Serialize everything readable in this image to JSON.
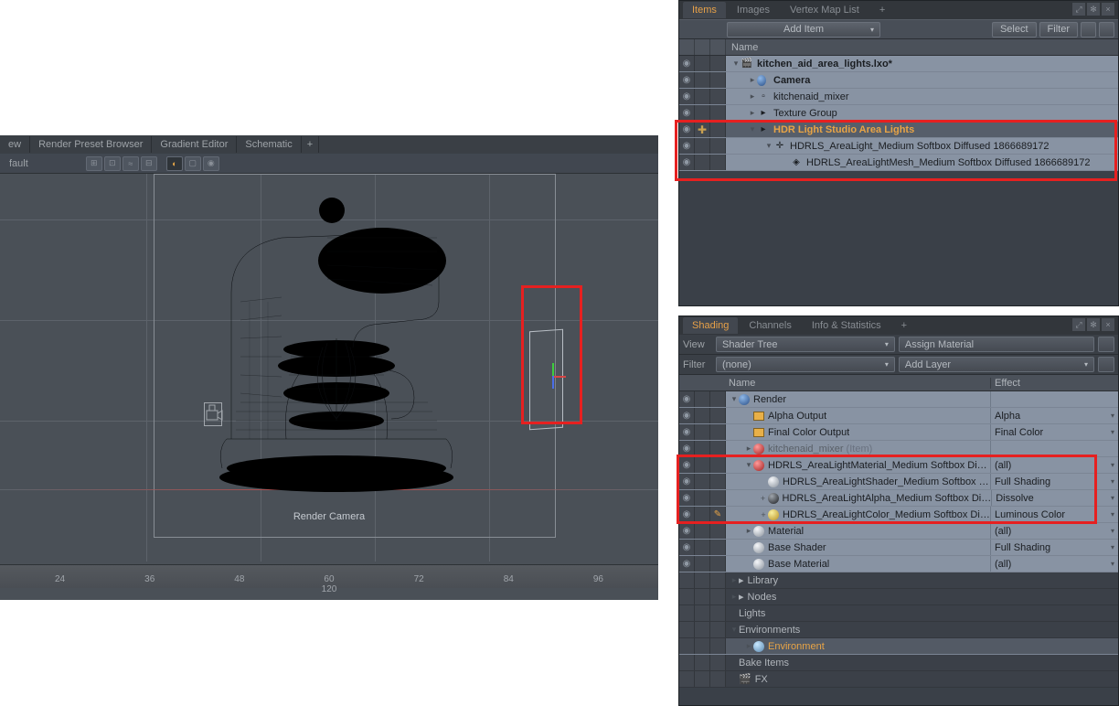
{
  "viewport": {
    "tabs": [
      "ew",
      "Render Preset Browser",
      "Gradient Editor",
      "Schematic"
    ],
    "toolbar_left": "fault",
    "camera_label": "Render Camera",
    "ruler": {
      "ticks": [
        "24",
        "36",
        "48",
        "60",
        "72",
        "84",
        "96"
      ],
      "center": "120"
    }
  },
  "items_panel": {
    "tabs": [
      "Items",
      "Images",
      "Vertex Map List"
    ],
    "add_item": "Add Item",
    "buttons": {
      "select": "Select",
      "filter": "Filter"
    },
    "header_name": "Name",
    "tree": [
      {
        "indent": 0,
        "icon": "film",
        "label": "kitchen_aid_area_lights.lxo*",
        "bold": true,
        "expander": "▾",
        "eye": true
      },
      {
        "indent": 1,
        "icon": "camera",
        "label": "Camera",
        "bold": true,
        "expander": "▸",
        "eye": true
      },
      {
        "indent": 1,
        "icon": "box",
        "label": "kitchenaid_mixer",
        "expander": "▸",
        "eye": true
      },
      {
        "indent": 1,
        "icon": "folder",
        "label": "Texture Group",
        "expander": "▸",
        "eye": true
      },
      {
        "indent": 1,
        "icon": "folder",
        "label": "HDR Light Studio Area Lights",
        "selected": true,
        "expander": "▾",
        "eye": true,
        "plus": true
      },
      {
        "indent": 2,
        "icon": "axes",
        "label": "HDRLS_AreaLight_Medium Softbox Diffused 1866689172",
        "expander": "▾",
        "eye": true
      },
      {
        "indent": 3,
        "icon": "mesh",
        "label": "HDRLS_AreaLightMesh_Medium Softbox Diffused 1866689172",
        "expander": "",
        "eye": true
      }
    ]
  },
  "shading_panel": {
    "tabs": [
      "Shading",
      "Channels",
      "Info & Statistics"
    ],
    "view": {
      "label": "View",
      "value": "Shader Tree",
      "right": "Assign Material"
    },
    "filter": {
      "label": "Filter",
      "value": "(none)",
      "right": "Add Layer",
      "caret": "▾"
    },
    "cols": {
      "name": "Name",
      "effect": "Effect"
    },
    "rows": [
      {
        "type": "sh",
        "indent": 0,
        "icon": "globe",
        "label": "Render",
        "eye": true,
        "exp": "▾",
        "effect": ""
      },
      {
        "type": "sh",
        "indent": 1,
        "icon": "img",
        "label": "Alpha Output",
        "eye": true,
        "effect": "Alpha"
      },
      {
        "type": "sh",
        "indent": 1,
        "icon": "img",
        "label": "Final Color Output",
        "eye": true,
        "effect": "Final Color"
      },
      {
        "type": "sh",
        "indent": 1,
        "icon": "red",
        "label": "kitchenaid_mixer",
        "sublabel": "(Item)",
        "eye": true,
        "dim": true,
        "exp": "▸",
        "effect": ""
      },
      {
        "type": "sh",
        "indent": 1,
        "icon": "red",
        "label": "HDRLS_AreaLightMaterial_Medium Softbox Di…",
        "eye": true,
        "exp": "▾",
        "effect": "(all)"
      },
      {
        "type": "sh",
        "indent": 2,
        "icon": "sphere",
        "label": "HDRLS_AreaLightShader_Medium Softbox …",
        "eye": true,
        "effect": "Full Shading"
      },
      {
        "type": "sh",
        "indent": 2,
        "icon": "dark",
        "label": "HDRLS_AreaLightAlpha_Medium Softbox Di…",
        "eye": true,
        "exp": "+",
        "effect": "Dissolve"
      },
      {
        "type": "sh",
        "indent": 2,
        "icon": "yellow",
        "label": "HDRLS_AreaLightColor_Medium Softbox Di…",
        "eye": true,
        "exp": "+",
        "edit": true,
        "effect": "Luminous Color"
      },
      {
        "type": "sh",
        "indent": 1,
        "icon": "sphere",
        "label": "Material",
        "eye": true,
        "exp": "▸",
        "effect": "(all)"
      },
      {
        "type": "sh",
        "indent": 1,
        "icon": "sphere",
        "label": "Base Shader",
        "eye": true,
        "effect": "Full Shading"
      },
      {
        "type": "sh",
        "indent": 1,
        "icon": "sphere",
        "label": "Base Material",
        "eye": true,
        "effect": "(all)"
      },
      {
        "type": "plain",
        "indent": 0,
        "icon": "folder",
        "label": "Library",
        "exp": "▸"
      },
      {
        "type": "plain",
        "indent": 0,
        "icon": "folder",
        "label": "Nodes",
        "exp": "▸"
      },
      {
        "type": "plain",
        "indent": 0,
        "label": "Lights"
      },
      {
        "type": "plain",
        "indent": 0,
        "label": "Environments",
        "exp": "▾"
      },
      {
        "type": "sel2",
        "indent": 1,
        "icon": "env",
        "label": "Environment",
        "exp": "▸"
      },
      {
        "type": "plain",
        "indent": 0,
        "label": "Bake Items"
      },
      {
        "type": "plain",
        "indent": 0,
        "icon": "film",
        "label": "FX"
      }
    ]
  }
}
